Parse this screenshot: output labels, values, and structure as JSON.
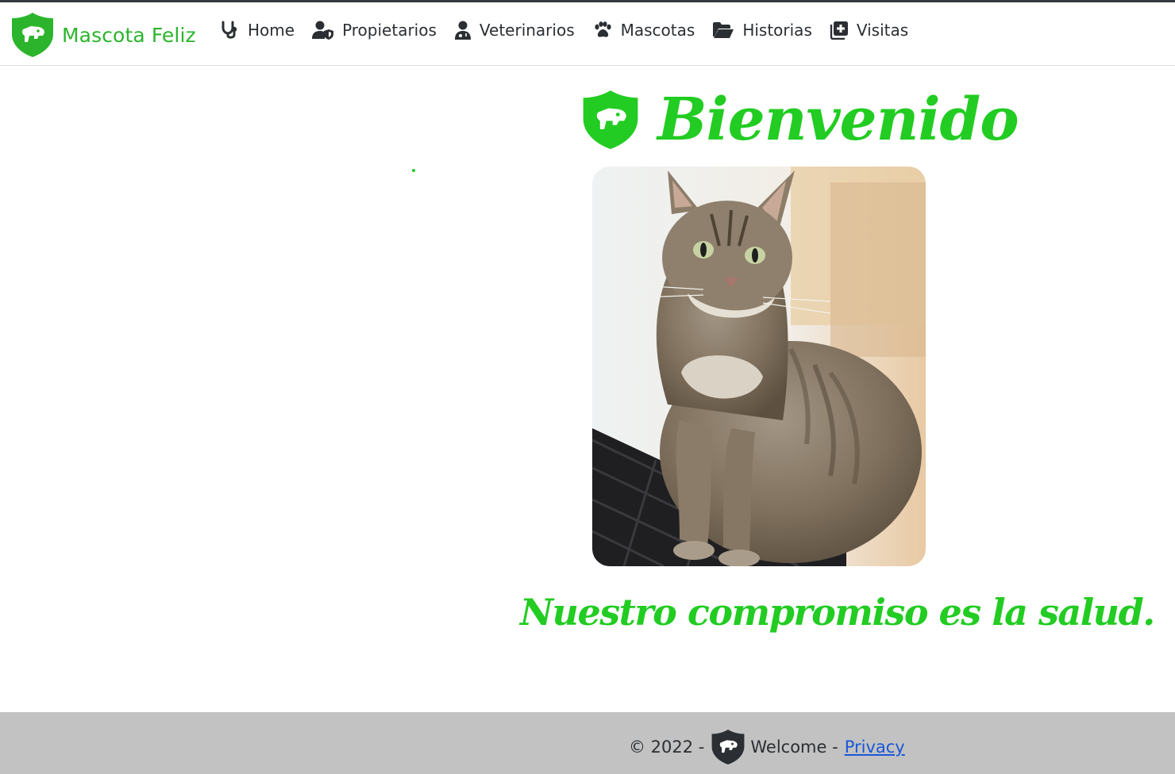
{
  "brand": {
    "name": "Mascota Feliz",
    "logo_icon": "shield-dog-icon",
    "color": "#2cb52c"
  },
  "nav": {
    "items": [
      {
        "label": "Home",
        "icon": "stethoscope-icon"
      },
      {
        "label": "Propietarios",
        "icon": "user-shield-icon"
      },
      {
        "label": "Veterinarios",
        "icon": "user-doctor-icon"
      },
      {
        "label": "Mascotas",
        "icon": "paw-icon"
      },
      {
        "label": "Historias",
        "icon": "folder-open-icon"
      },
      {
        "label": "Visitas",
        "icon": "notes-medical-icon"
      }
    ]
  },
  "hero": {
    "title": "Bienvenido",
    "tagline": "Nuestro compromiso es la salud.",
    "image": "cat-on-keyboard-photo",
    "accent_color": "#22cc22"
  },
  "footer": {
    "copyright": "© 2022 -",
    "welcome": "Welcome -",
    "privacy_link": "Privacy",
    "background": "#c2c2c2"
  }
}
